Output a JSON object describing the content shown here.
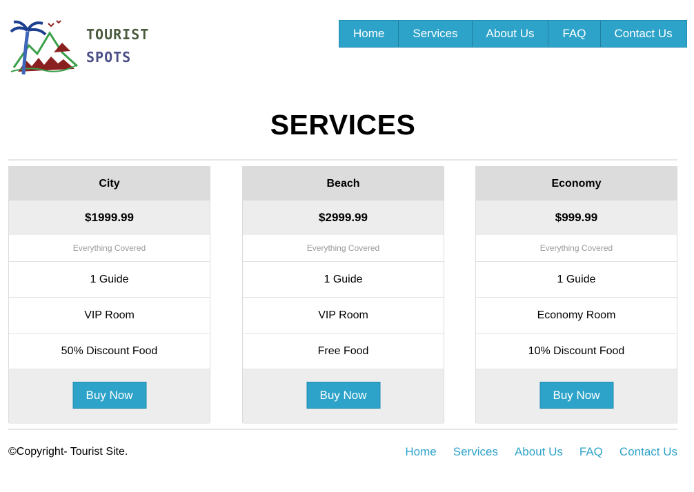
{
  "logo": {
    "line1": "TOURIST",
    "line2": "SPOTS"
  },
  "nav": [
    "Home",
    "Services",
    "About Us",
    "FAQ",
    "Contact Us"
  ],
  "page_title": "SERVICES",
  "plans": [
    {
      "name": "City",
      "price": "$1999.99",
      "note": "Everything Covered",
      "features": [
        "1 Guide",
        "VIP Room",
        "50% Discount Food"
      ],
      "button": "Buy Now"
    },
    {
      "name": "Beach",
      "price": "$2999.99",
      "note": "Everything Covered",
      "features": [
        "1 Guide",
        "VIP Room",
        "Free Food"
      ],
      "button": "Buy Now"
    },
    {
      "name": "Economy",
      "price": "$999.99",
      "note": "Everything Covered",
      "features": [
        "1 Guide",
        "Economy Room",
        "10% Discount Food"
      ],
      "button": "Buy Now"
    }
  ],
  "footer": {
    "copyright": "©Copyright- Tourist Site.",
    "links": [
      "Home",
      "Services",
      "About Us",
      "FAQ",
      "Contact Us"
    ]
  },
  "colors": {
    "accent": "#2ea3c9",
    "header_cell": "#dcdcdc",
    "price_cell": "#ededed"
  }
}
